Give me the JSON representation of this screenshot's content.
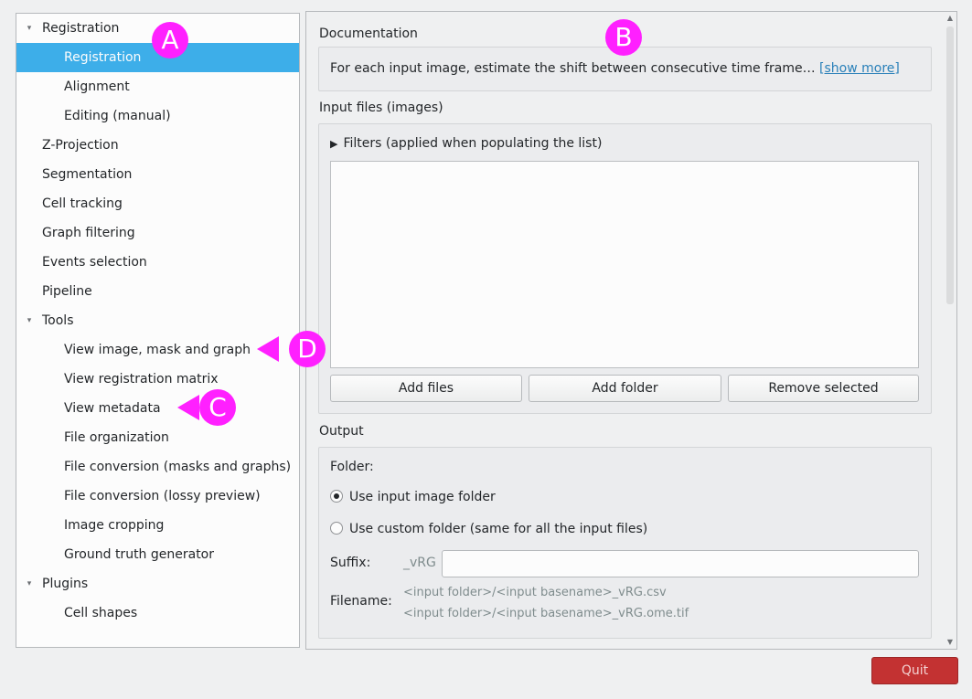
{
  "tree": {
    "items": [
      {
        "label": "Registration",
        "level": 0,
        "arrow": "▾",
        "selected": false
      },
      {
        "label": "Registration",
        "level": 1,
        "selected": true
      },
      {
        "label": "Alignment",
        "level": 1
      },
      {
        "label": "Editing (manual)",
        "level": 1
      },
      {
        "label": "Z-Projection",
        "level": 0
      },
      {
        "label": "Segmentation",
        "level": 0
      },
      {
        "label": "Cell tracking",
        "level": 0
      },
      {
        "label": "Graph filtering",
        "level": 0
      },
      {
        "label": "Events selection",
        "level": 0
      },
      {
        "label": "Pipeline",
        "level": 0
      },
      {
        "label": "Tools",
        "level": 0,
        "arrow": "▾"
      },
      {
        "label": "View image, mask and graph",
        "level": 1
      },
      {
        "label": "View registration matrix",
        "level": 1
      },
      {
        "label": "View metadata",
        "level": 1
      },
      {
        "label": "File organization",
        "level": 1
      },
      {
        "label": "File conversion (masks and graphs)",
        "level": 1
      },
      {
        "label": "File conversion (lossy preview)",
        "level": 1
      },
      {
        "label": "Image cropping",
        "level": 1
      },
      {
        "label": "Ground truth generator",
        "level": 1
      },
      {
        "label": "Plugins",
        "level": 0,
        "arrow": "▾"
      },
      {
        "label": "Cell shapes",
        "level": 1
      }
    ]
  },
  "documentation": {
    "title": "Documentation",
    "text": "For each input image, estimate the shift between consecutive time frame…",
    "show_more": "[show more]"
  },
  "input_files": {
    "title": "Input files (images)",
    "filters_label": "Filters (applied when populating the list)",
    "filters_arrow": "▶",
    "add_files": "Add files",
    "add_folder": "Add folder",
    "remove_selected": "Remove selected"
  },
  "output": {
    "title": "Output",
    "folder_label": "Folder:",
    "radio_input_folder": "Use input image folder",
    "radio_custom_folder": "Use custom folder (same for all the input files)",
    "radio_input_folder_checked": true,
    "suffix_label": "Suffix:",
    "suffix_prefix": "_vRG",
    "suffix_value": "",
    "filename_label": "Filename:",
    "filename_line1": "<input folder>/<input basename>_vRG.csv",
    "filename_line2": "<input folder>/<input basename>_vRG.ome.tif"
  },
  "quit_label": "Quit",
  "markers": {
    "a": "A",
    "b": "B",
    "c": "C",
    "d": "D"
  },
  "colors": {
    "selection": "#3daee9",
    "marker": "#ff20ff",
    "quit": "#c33232"
  }
}
